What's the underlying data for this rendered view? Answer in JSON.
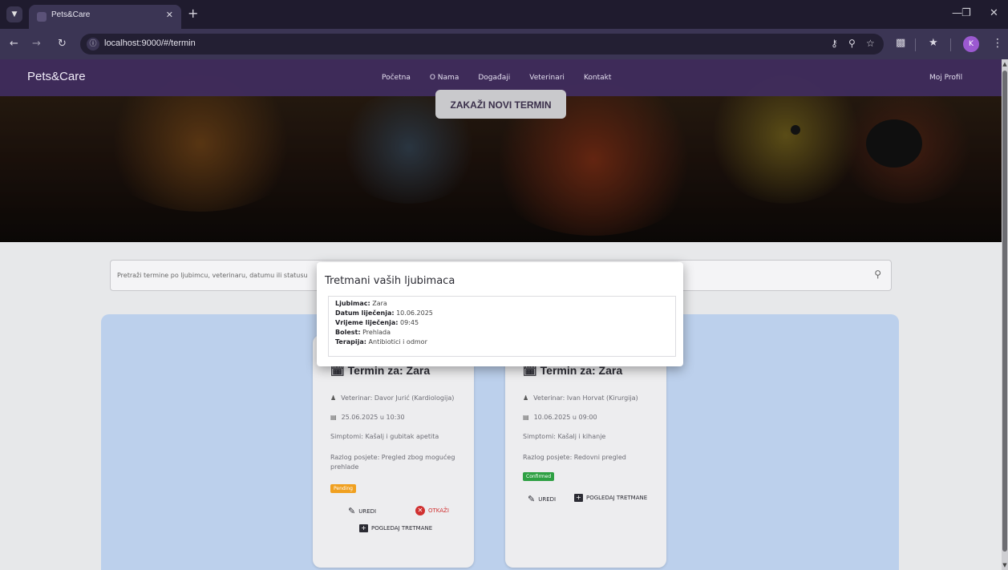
{
  "browser": {
    "tab_title": "Pets&Care",
    "url": "localhost:9000/#/termin",
    "profile_initial": "K"
  },
  "site": {
    "brand": "Pets&Care",
    "nav": [
      "Početna",
      "O Nama",
      "Događaji",
      "Veterinari",
      "Kontakt"
    ],
    "profile_link": "Moj Profil",
    "new_appointment_button": "ZAKAŽI NOVI TERMIN"
  },
  "search": {
    "placeholder": "Pretraži termine po ljubimcu, veterinaru, datumu ili statusu"
  },
  "appointments": [
    {
      "title": "Termin za: Zara",
      "vet": "Veterinar: Davor Jurić (Kardiologija)",
      "datetime": "25.06.2025 u 10:30",
      "symptoms": "Simptomi: Kašalj i gubitak apetita",
      "reason": "Razlog posjete: Pregled zbog mogućeg prehlade",
      "status": "Pending",
      "actions": {
        "edit": "UREDI",
        "cancel": "OTKAŽI",
        "view": "POGLEDAJ TRETMANE"
      }
    },
    {
      "title": "Termin za: Zara",
      "vet": "Veterinar: Ivan Horvat (Kirurgija)",
      "datetime": "10.06.2025 u 09:00",
      "symptoms": "Simptomi: Kašalj i kihanje",
      "reason": "Razlog posjete: Redovni pregled",
      "status": "Confirmed",
      "actions": {
        "edit": "UREDI",
        "view": "POGLEDAJ TRETMANE"
      }
    }
  ],
  "modal": {
    "title": "Tretmani vaših ljubimaca",
    "treatment": {
      "pet_label": "Ljubimac:",
      "pet": "Zara",
      "date_label": "Datum liječenja:",
      "date": "10.06.2025",
      "time_label": "Vrijeme liječenja:",
      "time": "09:45",
      "disease_label": "Bolest:",
      "disease": "Prehlada",
      "therapy_label": "Terapija:",
      "therapy": "Antibiotici i odmor"
    }
  },
  "colors": {
    "navbar": "#402c60",
    "panel": "#bcd0ec",
    "pending": "#f0a020",
    "confirmed": "#2ea043",
    "cancel": "#d03030"
  }
}
